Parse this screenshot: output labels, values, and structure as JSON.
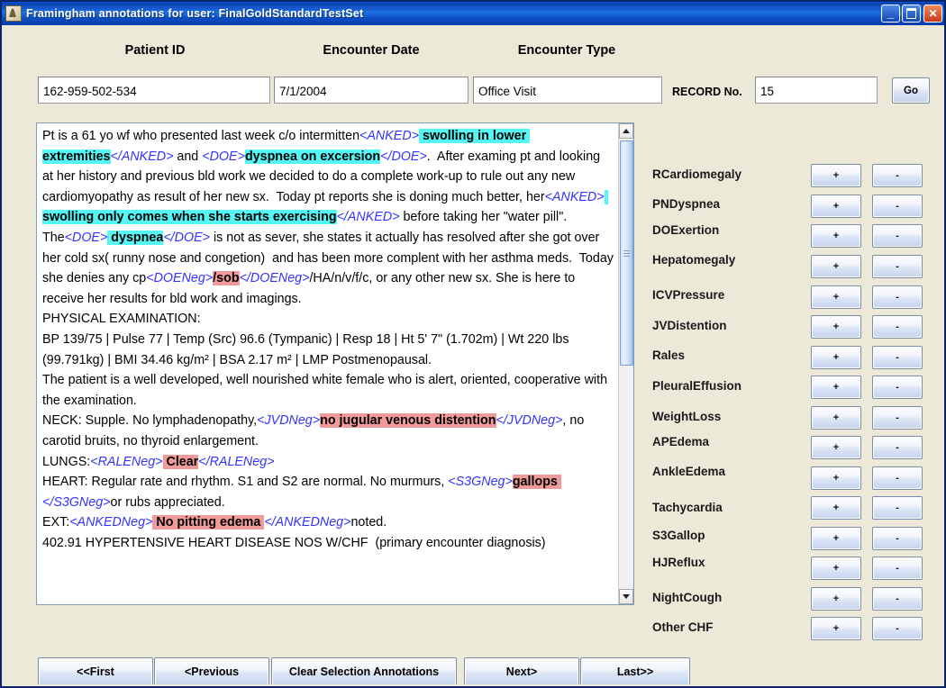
{
  "window": {
    "title": "Framingham annotations for user: FinalGoldStandardTestSet",
    "icon": "app-icon",
    "minimize_glyph": "_",
    "maximize_glyph": "",
    "close_glyph": "✕"
  },
  "form": {
    "labels": [
      {
        "text": "Patient ID"
      },
      {
        "text": "Encounter Date"
      },
      {
        "text": "Encounter Type"
      }
    ],
    "fields": [
      {
        "name": "patient-id-input",
        "value": "162-959-502-534",
        "placeholder": ""
      },
      {
        "name": "encounter-date-input",
        "value": "7/1/2004",
        "placeholder": ""
      },
      {
        "name": "encounter-type-input",
        "value": "Office Visit",
        "placeholder": ""
      }
    ],
    "record_label": "RECORD No.",
    "record_value": "15",
    "record_placeholder": "",
    "go_label": "Go"
  },
  "note": {
    "segments": [
      {
        "t": "Pt is a 61 yo wf who presented last week c/o intermitten",
        "k": "p"
      },
      {
        "t": "<ANKED>",
        "k": "tag"
      },
      {
        "t": " swolling in lower extremities",
        "k": "cy"
      },
      {
        "t": "</ANKED>",
        "k": "tag"
      },
      {
        "t": " and ",
        "k": "p"
      },
      {
        "t": "<DOE>",
        "k": "tag"
      },
      {
        "t": "dyspnea on excersion",
        "k": "cy"
      },
      {
        "t": "</DOE>",
        "k": "tag"
      },
      {
        "t": ".  After examing pt and looking at her history and previous bld work we decided to do a complete work-up to rule out any new cardiomyopathy as result of her new sx.  Today pt reports she is doning much better, her",
        "k": "p"
      },
      {
        "t": "<ANKED>",
        "k": "tag"
      },
      {
        "t": " swolling only comes when she starts exercising",
        "k": "cy"
      },
      {
        "t": "</ANKED>",
        "k": "tag"
      },
      {
        "t": " before taking her \"water pill\".  The",
        "k": "p"
      },
      {
        "t": "<DOE>",
        "k": "tag"
      },
      {
        "t": " dyspnea",
        "k": "cy"
      },
      {
        "t": "</DOE>",
        "k": "tag"
      },
      {
        "t": " is not as sever, she states it actually has resolved after she got over her cold sx( runny nose and congetion)  and has been more complent with her asthma meds.  Today she denies any cp",
        "k": "p"
      },
      {
        "t": "<DOENeg>",
        "k": "tag"
      },
      {
        "t": "/sob",
        "k": "rd"
      },
      {
        "t": "</DOENeg>",
        "k": "tag"
      },
      {
        "t": "/HA/n/v/f/c, or any other new sx. She is here to receive her results for bld work and imagings.\nPHYSICAL EXAMINATION:\nBP 139/75 | Pulse 77 | Temp (Src) 96.6 (Tympanic) | Resp 18 | Ht 5' 7\" (1.702m) | Wt 220 lbs (99.791kg) | BMI 34.46 kg/m² | BSA 2.17 m² | LMP Postmenopausal.\nThe patient is a well developed, well nourished white female who is alert, oriented, cooperative with the examination.\nNECK: Supple. No lymphadenopathy,",
        "k": "p"
      },
      {
        "t": "<JVDNeg>",
        "k": "tag"
      },
      {
        "t": "no jugular venous distention",
        "k": "rd"
      },
      {
        "t": "</JVDNeg>",
        "k": "tag"
      },
      {
        "t": ", no carotid bruits, no thyroid enlargement.\nLUNGS:",
        "k": "p"
      },
      {
        "t": "<RALENeg>",
        "k": "tag"
      },
      {
        "t": " Clear",
        "k": "rd"
      },
      {
        "t": "</RALENeg>",
        "k": "tag"
      },
      {
        "t": "\nHEART: Regular rate and rhythm. S1 and S2 are normal. No murmurs, ",
        "k": "p"
      },
      {
        "t": "<S3GNeg>",
        "k": "tag"
      },
      {
        "t": "gallops ",
        "k": "rd"
      },
      {
        "t": "</S3GNeg>",
        "k": "tag"
      },
      {
        "t": "or rubs appreciated.\nEXT:",
        "k": "p"
      },
      {
        "t": "<ANKEDNeg>",
        "k": "tag"
      },
      {
        "t": " No pitting edema ",
        "k": "rd"
      },
      {
        "t": "</ANKEDNeg>",
        "k": "tag"
      },
      {
        "t": "noted.\n402.91 HYPERTENSIVE HEART DISEASE NOS W/CHF  (primary encounter diagnosis)",
        "k": "p"
      }
    ],
    "scrollbar": {
      "up_arrow": "scroll-up-arrow",
      "down_arrow": "scroll-down-arrow"
    }
  },
  "annotations": {
    "plus_label": "+",
    "minus_label": "-",
    "items": [
      {
        "label": "RCardiomegaly"
      },
      {
        "label": "PNDyspnea"
      },
      {
        "label": "DOExertion"
      },
      {
        "label": "Hepatomegaly"
      },
      {
        "label": "ICVPressure"
      },
      {
        "label": "JVDistention"
      },
      {
        "label": "Rales"
      },
      {
        "label": "PleuralEffusion"
      },
      {
        "label": "WeightLoss"
      },
      {
        "label": "APEdema"
      },
      {
        "label": "AnkleEdema"
      },
      {
        "label": "Tachycardia"
      },
      {
        "label": "S3Gallop"
      },
      {
        "label": "HJReflux"
      },
      {
        "label": "NightCough"
      },
      {
        "label": "Other CHF"
      }
    ]
  },
  "navigation": {
    "buttons": [
      {
        "label": "<<First"
      },
      {
        "label": "<Previous"
      },
      {
        "label": "Clear Selection Annotations"
      },
      {
        "label": "Next>"
      },
      {
        "label": "Last>>"
      }
    ]
  },
  "colors": {
    "titlebar": "#0a41b5",
    "highlight_cyan": "#55f6f6",
    "highlight_red": "#f19a9a",
    "tag_blue": "#3333ff",
    "panel_bg": "#ece9d8"
  }
}
